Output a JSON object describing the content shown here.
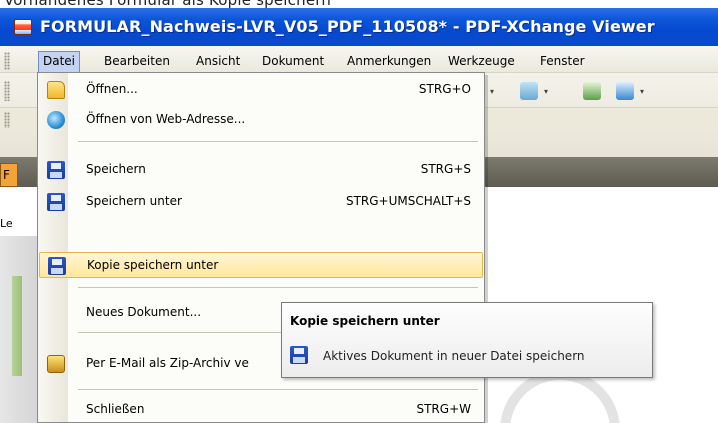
{
  "top_strip": {
    "caption": "Vorhandenes Formular als Kopie speichern"
  },
  "window": {
    "title": "FORMULAR_Nachweis-LVR_V05_PDF_110508* - PDF-XChange Viewer"
  },
  "menubar": {
    "items": [
      "Datei",
      "Bearbeiten",
      "Ansicht",
      "Dokument",
      "Anmerkungen",
      "Werkzeuge",
      "Fenster"
    ],
    "active": "Datei"
  },
  "dropdown": {
    "items": [
      {
        "label": "Öffnen...",
        "shortcut": "STRG+O",
        "icon": "folder-open-icon"
      },
      {
        "label": "Öffnen von Web-Adresse...",
        "shortcut": "",
        "icon": "globe-icon"
      },
      {
        "label": "Speichern",
        "shortcut": "STRG+S",
        "icon": "floppy-disk-icon"
      },
      {
        "label": "Speichern unter",
        "shortcut": "STRG+UMSCHALT+S",
        "icon": "floppy-disk-icon"
      },
      {
        "label": "Kopie speichern unter",
        "shortcut": "",
        "icon": "floppy-disk-icon",
        "highlighted": true
      },
      {
        "label": "Neues Dokument...",
        "shortcut": "",
        "icon": ""
      },
      {
        "label": "Per E-Mail als Zip-Archiv ve",
        "shortcut": "",
        "icon": "zip-mail-icon"
      },
      {
        "label": "Schließen",
        "shortcut": "STRG+W",
        "icon": ""
      }
    ]
  },
  "tooltip": {
    "title": "Kopie speichern unter",
    "description": "Aktives Dokument in neuer Datei speichern",
    "icon": "floppy-disk-icon"
  },
  "side": {
    "tab_letter": "F",
    "label": "Le"
  },
  "colors": {
    "titlebar": "#0b56d8",
    "menu_highlight": "#ffe79a",
    "tab_accent": "#f4a23a"
  }
}
